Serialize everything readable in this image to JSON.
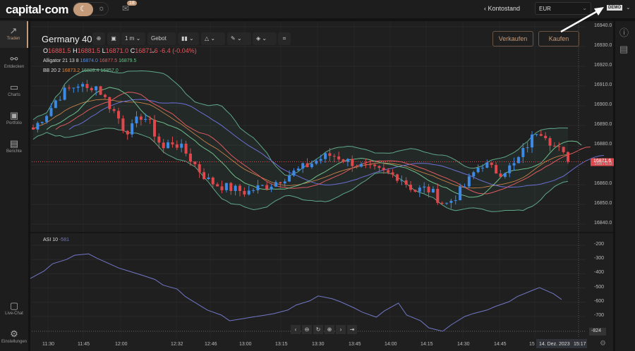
{
  "header": {
    "logo": "capital·com",
    "notifications": "18",
    "balance_label": "Kontostand",
    "currency": "EUR",
    "account_mode": "DEMO"
  },
  "sidebar": {
    "items": [
      {
        "label": "Traden",
        "icon": "trend-up-icon",
        "active": true
      },
      {
        "label": "Entdecken",
        "icon": "network-icon"
      },
      {
        "label": "Charts",
        "icon": "monitor-chart-icon",
        "badge": "!"
      },
      {
        "label": "Portfolio",
        "icon": "briefcase-icon"
      },
      {
        "label": "Berichte",
        "icon": "report-icon"
      },
      {
        "label": "Live-Chat",
        "icon": "chat-icon"
      },
      {
        "label": "Einstellungen",
        "icon": "gear-icon"
      }
    ]
  },
  "toolbar": {
    "instrument": "Germany 40",
    "interval": "1 m",
    "price_type": "Gebot"
  },
  "ohlc": {
    "o_label": "O",
    "o": "16881.5",
    "h_label": "H",
    "h": "16881.5",
    "l_label": "L",
    "l": "16871.0",
    "c_label": "C",
    "c": "16871.6",
    "change": "-6.4 (-0.04%)"
  },
  "indicators": {
    "alligator": {
      "label": "Alligator 21 13 8",
      "v1": "16874.0",
      "v2": "16877.5",
      "v3": "16879.5"
    },
    "bb": {
      "label": "BB 20 2",
      "v1": "16873.2",
      "v2": "16889.4",
      "v3": "16857.0"
    },
    "asi": {
      "label": "ASI 10",
      "value": "-581"
    }
  },
  "actions": {
    "sell": "Verkaufen",
    "buy": "Kaufen"
  },
  "colors": {
    "up": "#3d8ae6",
    "down": "#e0474c",
    "accent": "#c59a78",
    "alligator_jaw": "#6b6fd6",
    "alligator_teeth": "#e05a5f",
    "alligator_lips": "#6fbf8c",
    "bb_band": "#5fa88a",
    "bb_basis": "#d88a4a",
    "asi": "#7277c8"
  },
  "chart_data": [
    {
      "type": "candlestick",
      "title": "Germany 40",
      "ylim": [
        16835,
        16945
      ],
      "price_ticks": [
        "16940.0",
        "16930.0",
        "16920.0",
        "16910.0",
        "16900.0",
        "16890.0",
        "16880.0",
        "16870.0",
        "16860.0",
        "16850.0",
        "16840.0"
      ],
      "last_price": "16871.6",
      "x_ticks": [
        "11:30",
        "11:45",
        "12:00",
        "12:32",
        "12:46",
        "13:00",
        "13:15",
        "13:30",
        "13:45",
        "14:00",
        "14:15",
        "14:30",
        "14:45",
        "15"
      ],
      "cursor_date": "14. Dez. 2023",
      "cursor_time": "15:17",
      "closes": [
        16888,
        16893,
        16897,
        16903,
        16907,
        16909,
        16911,
        16908,
        16911,
        16906,
        16900,
        16895,
        16887,
        16889,
        16895,
        16893,
        16885,
        16878,
        16882,
        16880,
        16876,
        16871,
        16866,
        16862,
        16860,
        16859,
        16858,
        16857,
        16856,
        16858,
        16859,
        16860,
        16862,
        16864,
        16866,
        16868,
        16870,
        16872,
        16874,
        16875,
        16874,
        16872,
        16871,
        16869,
        16868,
        16867,
        16866,
        16865,
        16864,
        16860,
        16857,
        16858,
        16857,
        16853,
        16850,
        16853,
        16857,
        16862,
        16868,
        16871,
        16868,
        16866,
        16868,
        16870,
        16876,
        16882,
        16888,
        16886,
        16880,
        16877,
        16871.6
      ]
    },
    {
      "type": "line",
      "name": "ASI 10",
      "ylim": [
        -824,
        -150
      ],
      "ticks": [
        "-200",
        "-300",
        "-400",
        "-500",
        "-600",
        "-700"
      ],
      "last_value": "-824",
      "values": [
        -433,
        -380,
        -330,
        -300,
        -270,
        -260,
        -290,
        -334,
        -360,
        -390,
        -408,
        -440,
        -480,
        -507,
        -560,
        -620,
        -655,
        -690,
        -730,
        -715,
        -705,
        -690,
        -680,
        -655,
        -620,
        -590,
        -556,
        -575,
        -596,
        -640,
        -670,
        -705,
        -660,
        -606,
        -690,
        -730,
        -780,
        -804,
        -760,
        -700,
        -680,
        -655,
        -630,
        -596,
        -560,
        -520,
        -497,
        -540,
        -581
      ]
    }
  ]
}
